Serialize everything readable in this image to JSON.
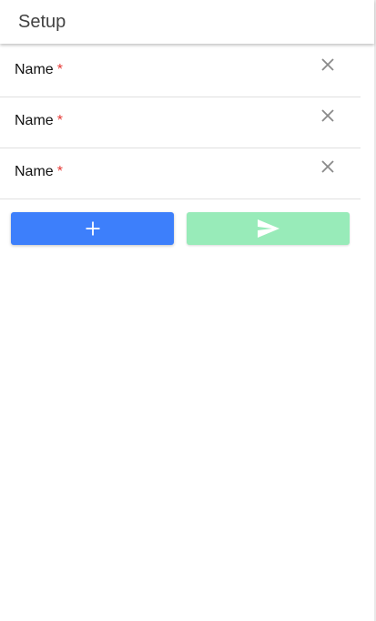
{
  "header": {
    "title": "Setup"
  },
  "fields": [
    {
      "label": "Name",
      "required_marker": "*",
      "remove_icon": "close-icon"
    },
    {
      "label": "Name",
      "required_marker": "*",
      "remove_icon": "close-icon"
    },
    {
      "label": "Name",
      "required_marker": "*",
      "remove_icon": "close-icon"
    }
  ],
  "actions": {
    "add_icon": "plus-icon",
    "send_icon": "send-icon"
  },
  "colors": {
    "add_button": "#3d7ffb",
    "send_button_disabled": "#98ebb9",
    "required_star": "#e53935",
    "icon_gray": "#8a8a8a"
  }
}
